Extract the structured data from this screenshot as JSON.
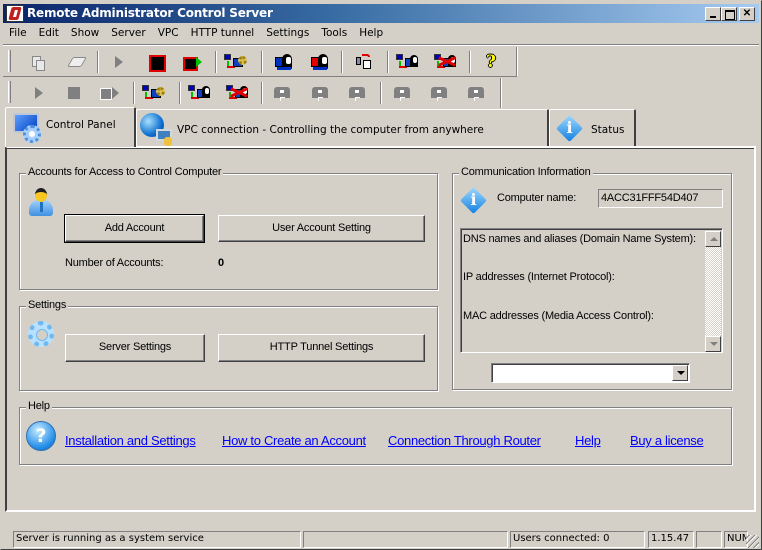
{
  "window": {
    "title": "Remote Administrator Control Server",
    "controls": {
      "minimize": "minimize",
      "maximize": "maximize",
      "close": "✕"
    }
  },
  "menu": [
    "File",
    "Edit",
    "Show",
    "Server",
    "VPC",
    "HTTP tunnel",
    "Settings",
    "Tools",
    "Help"
  ],
  "toolbar1": {
    "icons": [
      "copy-icon",
      "eraser-icon",
      "play-icon",
      "stop-icon",
      "stop-and-start-icon",
      "network-settings-icon",
      "connect-user-icon",
      "disconnect-user-icon",
      "file-transfer-icon",
      "connect-network-user-icon",
      "disconnect-network-user-icon",
      "help-icon"
    ],
    "help_glyph": "?"
  },
  "toolbar2": {
    "icons": [
      "play-icon",
      "stop-icon",
      "stop-and-start-icon",
      "network-settings-icon",
      "connect-network-user-icon",
      "disconnect-network-user-icon",
      "monitor-icon",
      "monitor-icon",
      "monitor-icon",
      "monitor-icon",
      "monitor-icon",
      "monitor-icon"
    ]
  },
  "tabs": [
    {
      "label": "Control Panel",
      "icon": "control-panel-icon",
      "active": true
    },
    {
      "label": "VPC connection - Controlling the computer from anywhere",
      "icon": "vpc-globe-icon",
      "active": false
    },
    {
      "label": "Status",
      "icon": "info-icon",
      "active": false
    }
  ],
  "accounts": {
    "title": "Accounts for Access to Control Computer",
    "add_button": "Add Account",
    "settings_button": "User Account Setting",
    "count_label": "Number of Accounts:",
    "count_value": "0"
  },
  "settings": {
    "title": "Settings",
    "server_button": "Server Settings",
    "http_button": "HTTP Tunnel Settings"
  },
  "communication": {
    "title": "Communication Information",
    "computer_name_label": "Computer name:",
    "computer_name_value": "4ACC31FFF54D407",
    "info_glyph": "i",
    "list_lines": [
      "DNS names and aliases (Domain Name System):",
      "IP addresses (Internet Protocol):",
      "MAC addresses (Media Access Control):"
    ],
    "combo_value": ""
  },
  "help": {
    "title": "Help",
    "glyph": "?",
    "links": [
      "Installation and Settings",
      "How to Create an Account",
      "Connection Through Router",
      "Help",
      "Buy a license"
    ],
    "link_color": "#0000ff"
  },
  "statusbar": {
    "message": "Server is running as a system service",
    "pane2": "",
    "users": "Users connected: 0",
    "version": "1.15.47",
    "pane5": "",
    "num": "NUM"
  }
}
